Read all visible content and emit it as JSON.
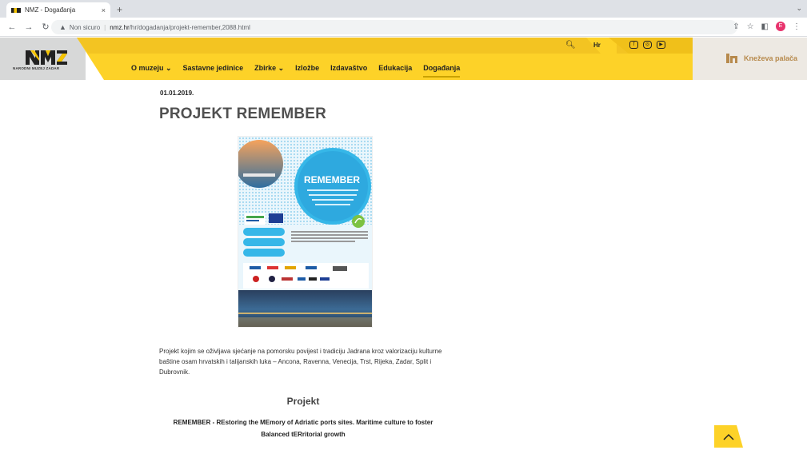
{
  "browser": {
    "tab_title": "NMZ - Događanja",
    "tab_close": "×",
    "new_tab": "+",
    "security_label": "Non sicuro",
    "url_host": "nmz.hr",
    "url_path": "/hr/dogadanja/projekt-remember,2088.html",
    "profile_initial": "E"
  },
  "header": {
    "logo_text": "NARODNI MUZEJ ZADAR",
    "language": "Hr",
    "palace_link": "Kneževa palača",
    "menu": [
      {
        "label": "O muzeju ⌄"
      },
      {
        "label": "Sastavne jedinice"
      },
      {
        "label": "Zbirke ⌄"
      },
      {
        "label": "Izložbe"
      },
      {
        "label": "Izdavaštvo"
      },
      {
        "label": "Edukacija"
      },
      {
        "label": "Događanja"
      }
    ],
    "colors": {
      "yellow": "#fdd228",
      "yellow_dark": "#f0c21a",
      "gray": "#d7d8d8"
    }
  },
  "article": {
    "date": "01.01.2019.",
    "title": "PROJEKT REMEMBER",
    "intro": "Projekt kojim se oživljava sjećanje na pomorsku povijest i tradiciju Jadrana kroz valorizaciju kulturne baštine osam hrvatskih i talijanskih luka – Ancona, Ravenna, Venecija, Trst, Rijeka, Zadar, Split i Dubrovnik.",
    "section_title": "Projekt",
    "section_subtitle": "REMEMBER - REstoring the MEmory of Adriatic ports sites. Maritime culture to foster Balanced tERritorial growth"
  },
  "poster": {
    "title": "REMEMBER",
    "tagline": "REstoring the MEmory of Adriatic ports sites Maritime culture to foster Balanced tERritorial growth",
    "program": "Interreg Italy – Croatia"
  }
}
